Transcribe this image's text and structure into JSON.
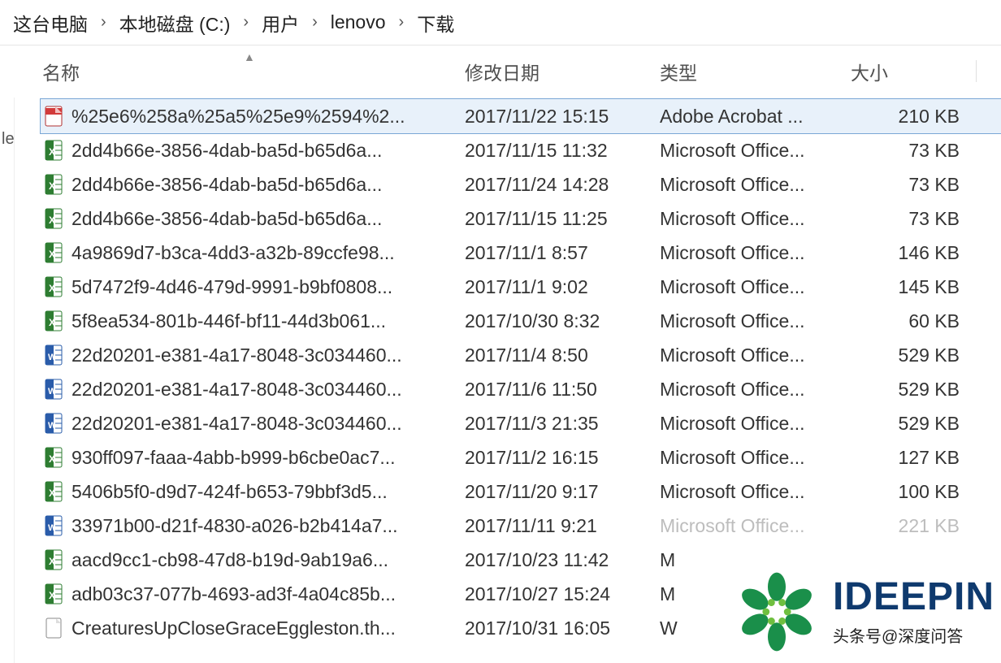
{
  "breadcrumb": {
    "items": [
      "这台电脑",
      "本地磁盘 (C:)",
      "用户",
      "lenovo",
      "下载"
    ]
  },
  "columns": {
    "name": "名称",
    "date": "修改日期",
    "type": "类型",
    "size": "大小",
    "sort": "▲"
  },
  "left_sliver": "le",
  "icons": {
    "pdf": "pdf-icon",
    "xls": "excel-icon",
    "doc": "word-icon",
    "thm": "file-icon",
    "chevron": "›"
  },
  "files": [
    {
      "icon": "pdf",
      "name": "%25e6%258a%25a5%25e9%2594%2...",
      "date": "2017/11/22 15:15",
      "type": "Adobe Acrobat ...",
      "size": "210 KB",
      "selected": true
    },
    {
      "icon": "xls",
      "name": "2dd4b66e-3856-4dab-ba5d-b65d6a...",
      "date": "2017/11/15 11:32",
      "type": "Microsoft Office...",
      "size": "73 KB"
    },
    {
      "icon": "xls",
      "name": "2dd4b66e-3856-4dab-ba5d-b65d6a...",
      "date": "2017/11/24 14:28",
      "type": "Microsoft Office...",
      "size": "73 KB"
    },
    {
      "icon": "xls",
      "name": "2dd4b66e-3856-4dab-ba5d-b65d6a...",
      "date": "2017/11/15 11:25",
      "type": "Microsoft Office...",
      "size": "73 KB"
    },
    {
      "icon": "xls",
      "name": "4a9869d7-b3ca-4dd3-a32b-89ccfe98...",
      "date": "2017/11/1 8:57",
      "type": "Microsoft Office...",
      "size": "146 KB"
    },
    {
      "icon": "xls",
      "name": "5d7472f9-4d46-479d-9991-b9bf0808...",
      "date": "2017/11/1 9:02",
      "type": "Microsoft Office...",
      "size": "145 KB"
    },
    {
      "icon": "xls",
      "name": "5f8ea534-801b-446f-bf11-44d3b061...",
      "date": "2017/10/30 8:32",
      "type": "Microsoft Office...",
      "size": "60 KB"
    },
    {
      "icon": "doc",
      "name": "22d20201-e381-4a17-8048-3c034460...",
      "date": "2017/11/4 8:50",
      "type": "Microsoft Office...",
      "size": "529 KB"
    },
    {
      "icon": "doc",
      "name": "22d20201-e381-4a17-8048-3c034460...",
      "date": "2017/11/6 11:50",
      "type": "Microsoft Office...",
      "size": "529 KB"
    },
    {
      "icon": "doc",
      "name": "22d20201-e381-4a17-8048-3c034460...",
      "date": "2017/11/3 21:35",
      "type": "Microsoft Office...",
      "size": "529 KB"
    },
    {
      "icon": "xls",
      "name": "930ff097-faaa-4abb-b999-b6cbe0ac7...",
      "date": "2017/11/2 16:15",
      "type": "Microsoft Office...",
      "size": "127 KB"
    },
    {
      "icon": "xls",
      "name": "5406b5f0-d9d7-424f-b653-79bbf3d5...",
      "date": "2017/11/20 9:17",
      "type": "Microsoft Office...",
      "size": "100 KB"
    },
    {
      "icon": "doc",
      "name": "33971b00-d21f-4830-a026-b2b414a7...",
      "date": "2017/11/11 9:21",
      "type": "Microsoft Office...",
      "size": "221 KB",
      "faded": true
    },
    {
      "icon": "xls",
      "name": "aacd9cc1-cb98-47d8-b19d-9ab19a6...",
      "date": "2017/10/23 11:42",
      "type": "M",
      "size": ""
    },
    {
      "icon": "xls",
      "name": "adb03c37-077b-4693-ad3f-4a04c85b...",
      "date": "2017/10/27 15:24",
      "type": "M",
      "size": ""
    },
    {
      "icon": "thm",
      "name": "CreaturesUpCloseGraceEggleston.th...",
      "date": "2017/10/31 16:05",
      "type": "W",
      "size": ""
    }
  ],
  "watermark": {
    "brand": "IDEEPIN",
    "sub": "头条号@深度问答"
  }
}
